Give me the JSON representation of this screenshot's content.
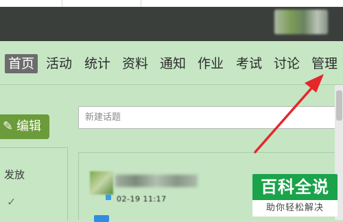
{
  "nav": {
    "items": [
      "首页",
      "活动",
      "统计",
      "资料",
      "通知",
      "作业",
      "考试",
      "讨论",
      "管理"
    ],
    "active_index": 0
  },
  "sidebar": {
    "edit_label": "编辑",
    "status_label": "发放"
  },
  "search": {
    "placeholder": "新建话题"
  },
  "post": {
    "time": "02-19 11:17"
  },
  "watermark": {
    "title": "百科全说",
    "subtitle": "助你轻松解决"
  },
  "colors": {
    "page_bg": "#c6e6c4",
    "header_bg": "#3b3f3c",
    "active_tab": "#6c6c6c",
    "edit_button": "#6b9b3a",
    "arrow": "#e5262a",
    "watermark_green": "#1aa34a"
  },
  "icons": {
    "edit": "pencil-icon",
    "status": "check-icon"
  }
}
